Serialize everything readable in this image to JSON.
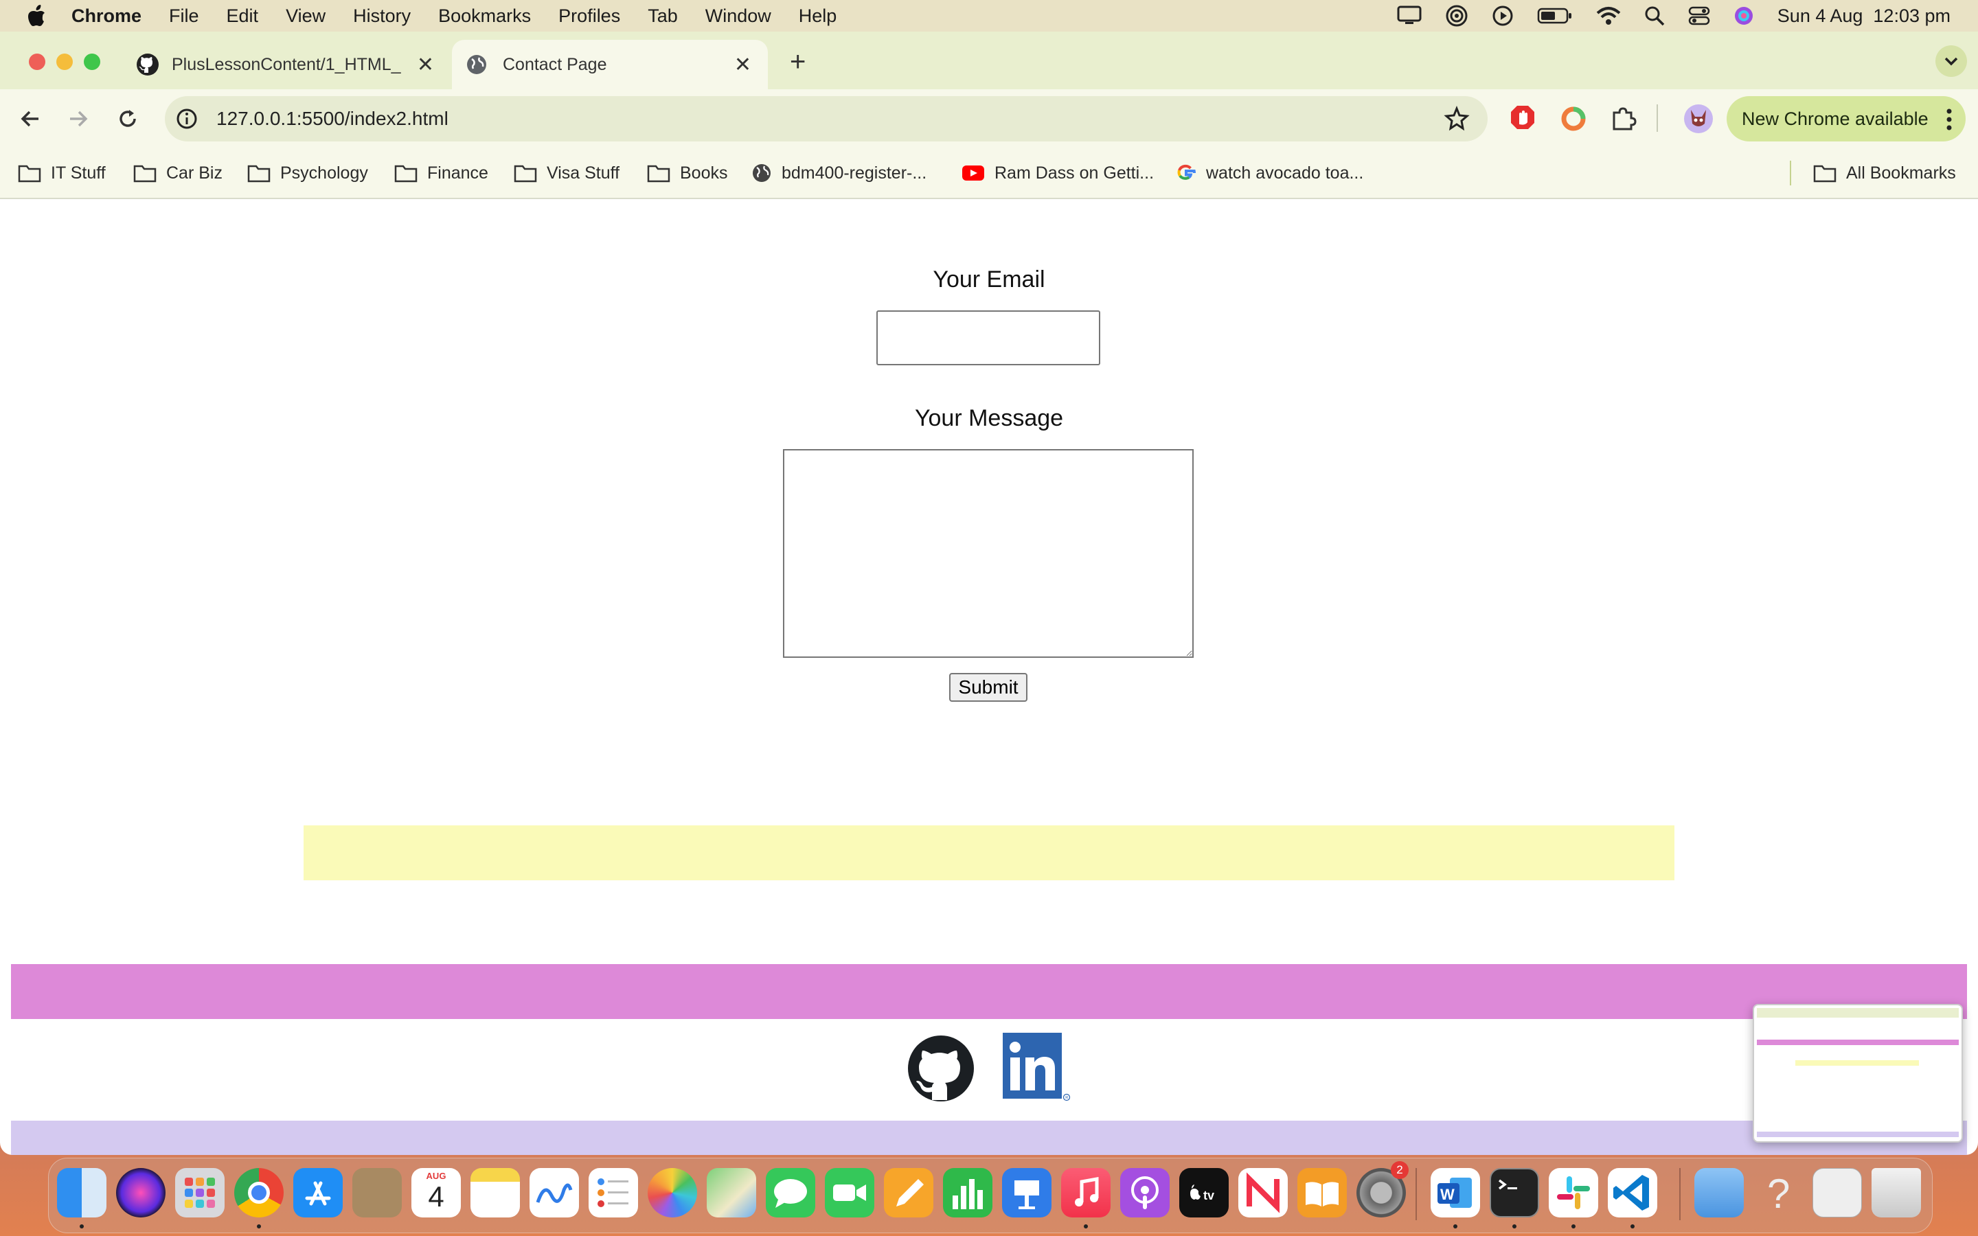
{
  "menubar": {
    "app_name": "Chrome",
    "menus": [
      "File",
      "Edit",
      "View",
      "History",
      "Bookmarks",
      "Profiles",
      "Tab",
      "Window",
      "Help"
    ],
    "datetime": "Sun 4 Aug  12:03 pm"
  },
  "tabs": [
    {
      "title": "PlusLessonContent/1_HTML_",
      "icon": "github-icon",
      "active": false
    },
    {
      "title": "Contact Page",
      "icon": "globe-icon",
      "active": true
    }
  ],
  "toolbar": {
    "url": "127.0.0.1:5500/index2.html",
    "update_label": "New Chrome available"
  },
  "bookmarks": [
    {
      "label": "IT Stuff",
      "icon": "folder-icon"
    },
    {
      "label": "Car Biz",
      "icon": "folder-icon"
    },
    {
      "label": "Psychology",
      "icon": "folder-icon"
    },
    {
      "label": "Finance",
      "icon": "folder-icon"
    },
    {
      "label": "Visa Stuff",
      "icon": "folder-icon"
    },
    {
      "label": "Books",
      "icon": "folder-icon"
    },
    {
      "label": "bdm400-register-...",
      "icon": "globe-icon"
    },
    {
      "label": "Ram Dass on Getti...",
      "icon": "youtube-icon"
    },
    {
      "label": "watch avocado toa...",
      "icon": "google-icon"
    }
  ],
  "all_bookmarks_label": "All Bookmarks",
  "form": {
    "email_label": "Your Email",
    "email_value": "",
    "message_label": "Your Message",
    "message_value": "",
    "submit_label": "Submit"
  },
  "colors": {
    "yellow_band": "#fafab8",
    "pink_band": "#dd89d8",
    "lavender_band": "#d4c9f0",
    "linkedin_blue": "#2d65b0"
  },
  "social_icons": [
    "github-icon",
    "linkedin-icon"
  ],
  "dock": {
    "calendar_month": "AUG",
    "calendar_day": "4",
    "settings_badge": "2"
  }
}
